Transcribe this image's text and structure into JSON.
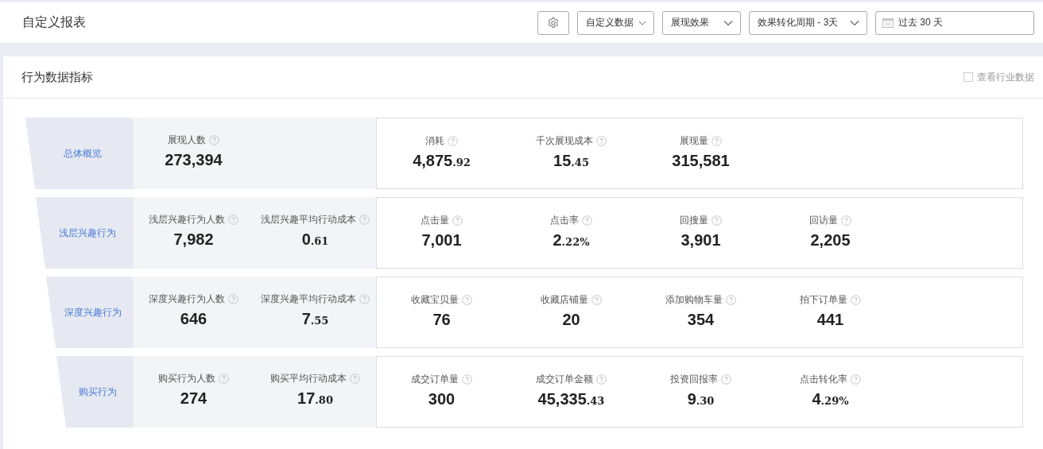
{
  "header": {
    "title": "自定义报表",
    "selects": [
      {
        "label": "自定义数据"
      },
      {
        "label": "展现效果"
      },
      {
        "label": "效果转化周期 - 3天"
      }
    ],
    "date_field": {
      "value": "过去 30 天"
    }
  },
  "panel": {
    "title": "行为数据指标",
    "industry_checkbox": {
      "label": "查看行业数据",
      "checked": false
    }
  },
  "stages": [
    {
      "label": "总体概览",
      "people_metrics": [
        {
          "label": "展现人数",
          "value": "273,394"
        }
      ],
      "metrics": [
        {
          "label": "消耗",
          "value": "4,875",
          "fraction": ".92"
        },
        {
          "label": "千次展现成本",
          "value": "15",
          "fraction": ".45"
        },
        {
          "label": "展现量",
          "value": "315,581"
        }
      ]
    },
    {
      "label": "浅层兴趣行为",
      "people_metrics": [
        {
          "label": "浅层兴趣行为人数",
          "value": "7,982"
        },
        {
          "label": "浅层兴趣平均行动成本",
          "value": "0",
          "fraction": ".61"
        }
      ],
      "metrics": [
        {
          "label": "点击量",
          "value": "7,001"
        },
        {
          "label": "点击率",
          "value": "2",
          "fraction": ".22%"
        },
        {
          "label": "回搜量",
          "value": "3,901"
        },
        {
          "label": "回访量",
          "value": "2,205"
        }
      ]
    },
    {
      "label": "深度兴趣行为",
      "people_metrics": [
        {
          "label": "深度兴趣行为人数",
          "value": "646"
        },
        {
          "label": "深度兴趣平均行动成本",
          "value": "7",
          "fraction": ".55"
        }
      ],
      "metrics": [
        {
          "label": "收藏宝贝量",
          "value": "76"
        },
        {
          "label": "收藏店铺量",
          "value": "20"
        },
        {
          "label": "添加购物车量",
          "value": "354"
        },
        {
          "label": "拍下订单量",
          "value": "441"
        }
      ]
    },
    {
      "label": "购买行为",
      "people_metrics": [
        {
          "label": "购买行为人数",
          "value": "274"
        },
        {
          "label": "购买平均行动成本",
          "value": "17",
          "fraction": ".80"
        }
      ],
      "metrics": [
        {
          "label": "成交订单量",
          "value": "300"
        },
        {
          "label": "成交订单金额",
          "value": "45,335",
          "fraction": ".43"
        },
        {
          "label": "投资回报率",
          "value": "9",
          "fraction": ".30"
        },
        {
          "label": "点击转化率",
          "value": "4",
          "fraction": ".29%"
        }
      ]
    }
  ]
}
